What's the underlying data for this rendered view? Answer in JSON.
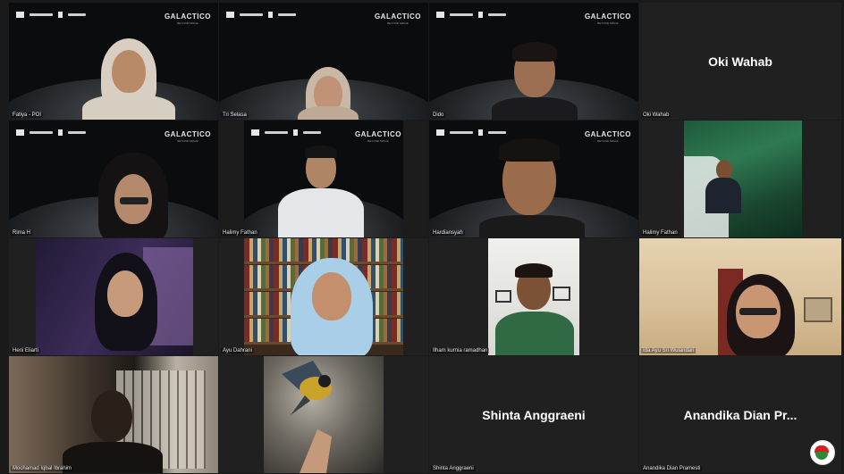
{
  "banner": {
    "brand": "GALACTICO",
    "tagline": "BEYOND SPACE"
  },
  "participants": [
    {
      "name": "Fatiya - POI"
    },
    {
      "name": "Tri Selasa"
    },
    {
      "name": "Dido"
    },
    {
      "name": "Oki Wahab",
      "display": "Oki Wahab"
    },
    {
      "name": "Rima H"
    },
    {
      "name": "Halimy Fathan"
    },
    {
      "name": "Hardiansyah"
    },
    {
      "name": "Halimy Fathan"
    },
    {
      "name": "Heni Eliarti"
    },
    {
      "name": "Ayu Dahrani"
    },
    {
      "name": "Ilham kurnia ramadhan"
    },
    {
      "name": "Ida Ayu Sri Wulandari"
    },
    {
      "name": "Mochamad Iqbal Ibrahim"
    },
    {
      "name": ""
    },
    {
      "name": "Shinta Anggraeni",
      "display": "Shinta Anggraeni"
    },
    {
      "name": "Anandika Dian Pramesti",
      "display": "Anandika Dian Pr..."
    }
  ],
  "colors": {
    "accent_red": "#d62020",
    "accent_green": "#2d8a3c",
    "background": "#1a1a1a"
  }
}
